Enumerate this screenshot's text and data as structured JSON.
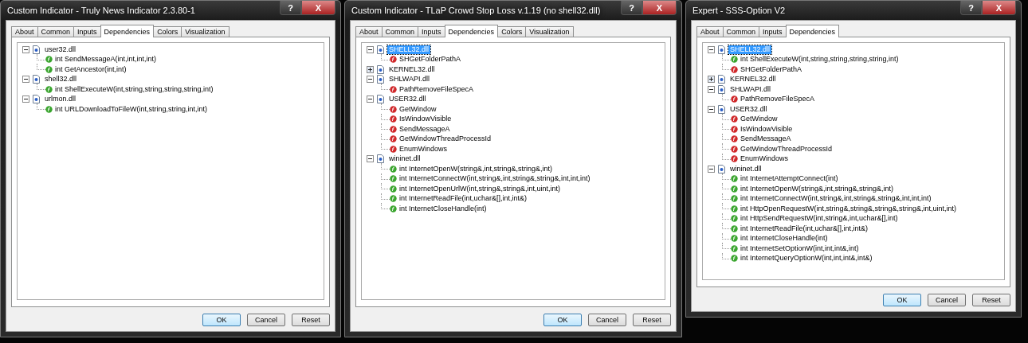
{
  "windows": [
    {
      "title": "Custom Indicator - Truly News Indicator 2.3.80-1",
      "help": "?",
      "close": "X",
      "tabs": [
        {
          "label": "About",
          "selected": false
        },
        {
          "label": "Common",
          "selected": false
        },
        {
          "label": "Inputs",
          "selected": false
        },
        {
          "label": "Dependencies",
          "selected": true
        },
        {
          "label": "Colors",
          "selected": false
        },
        {
          "label": "Visualization",
          "selected": false
        }
      ],
      "tree": [
        {
          "label": "user32.dll",
          "expanded": true,
          "selected": false,
          "children": [
            {
              "label": "int SendMessageA(int,int,int,int)",
              "kind": "allowed"
            },
            {
              "label": "int GetAncestor(int,int)",
              "kind": "allowed"
            }
          ]
        },
        {
          "label": "shell32.dll",
          "expanded": true,
          "selected": false,
          "children": [
            {
              "label": "int ShellExecuteW(int,string,string,string,string,int)",
              "kind": "allowed"
            }
          ]
        },
        {
          "label": "urlmon.dll",
          "expanded": true,
          "selected": false,
          "children": [
            {
              "label": "int URLDownloadToFileW(int,string,string,int,int)",
              "kind": "allowed"
            }
          ]
        }
      ],
      "buttons": [
        {
          "label": "OK",
          "default": true
        },
        {
          "label": "Cancel",
          "default": false
        },
        {
          "label": "Reset",
          "default": false
        }
      ]
    },
    {
      "title": "Custom Indicator - TLaP Crowd Stop Loss v.1.19 (no shell32.dll)",
      "help": "?",
      "close": "X",
      "tabs": [
        {
          "label": "About",
          "selected": false
        },
        {
          "label": "Common",
          "selected": false
        },
        {
          "label": "Inputs",
          "selected": false
        },
        {
          "label": "Dependencies",
          "selected": true
        },
        {
          "label": "Colors",
          "selected": false
        },
        {
          "label": "Visualization",
          "selected": false
        }
      ],
      "tree": [
        {
          "label": "SHELL32.dll",
          "expanded": true,
          "selected": true,
          "children": [
            {
              "label": "SHGetFolderPathA",
              "kind": "blocked"
            }
          ]
        },
        {
          "label": "KERNEL32.dll",
          "expanded": false,
          "selected": false
        },
        {
          "label": "SHLWAPI.dll",
          "expanded": true,
          "selected": false,
          "children": [
            {
              "label": "PathRemoveFileSpecA",
              "kind": "blocked"
            }
          ]
        },
        {
          "label": "USER32.dll",
          "expanded": true,
          "selected": false,
          "children": [
            {
              "label": "GetWindow",
              "kind": "blocked"
            },
            {
              "label": "IsWindowVisible",
              "kind": "blocked"
            },
            {
              "label": "SendMessageA",
              "kind": "blocked"
            },
            {
              "label": "GetWindowThreadProcessId",
              "kind": "blocked"
            },
            {
              "label": "EnumWindows",
              "kind": "blocked"
            }
          ]
        },
        {
          "label": "wininet.dll",
          "expanded": true,
          "selected": false,
          "children": [
            {
              "label": "int InternetOpenW(string&,int,string&,string&,int)",
              "kind": "allowed"
            },
            {
              "label": "int InternetConnectW(int,string&,int,string&,string&,int,int,int)",
              "kind": "allowed"
            },
            {
              "label": "int InternetOpenUrlW(int,string&,string&,int,uint,int)",
              "kind": "allowed"
            },
            {
              "label": "int InternetReadFile(int,uchar&[],int,int&)",
              "kind": "allowed"
            },
            {
              "label": "int InternetCloseHandle(int)",
              "kind": "allowed"
            }
          ]
        }
      ],
      "buttons": [
        {
          "label": "OK",
          "default": true
        },
        {
          "label": "Cancel",
          "default": false
        },
        {
          "label": "Reset",
          "default": false
        }
      ]
    },
    {
      "title": "Expert - SSS-Option V2",
      "help": "?",
      "close": "X",
      "tabs": [
        {
          "label": "About",
          "selected": false
        },
        {
          "label": "Common",
          "selected": false
        },
        {
          "label": "Inputs",
          "selected": false
        },
        {
          "label": "Dependencies",
          "selected": true
        }
      ],
      "tree": [
        {
          "label": "SHELL32.dll",
          "expanded": true,
          "selected": true,
          "children": [
            {
              "label": "int ShellExecuteW(int,string,string,string,string,int)",
              "kind": "allowed"
            },
            {
              "label": "SHGetFolderPathA",
              "kind": "blocked"
            }
          ]
        },
        {
          "label": "KERNEL32.dll",
          "expanded": false,
          "selected": false
        },
        {
          "label": "SHLWAPI.dll",
          "expanded": true,
          "selected": false,
          "children": [
            {
              "label": "PathRemoveFileSpecA",
              "kind": "blocked"
            }
          ]
        },
        {
          "label": "USER32.dll",
          "expanded": true,
          "selected": false,
          "children": [
            {
              "label": "GetWindow",
              "kind": "blocked"
            },
            {
              "label": "IsWindowVisible",
              "kind": "blocked"
            },
            {
              "label": "SendMessageA",
              "kind": "blocked"
            },
            {
              "label": "GetWindowThreadProcessId",
              "kind": "blocked"
            },
            {
              "label": "EnumWindows",
              "kind": "blocked"
            }
          ]
        },
        {
          "label": "wininet.dll",
          "expanded": true,
          "selected": false,
          "children": [
            {
              "label": "int InternetAttemptConnect(int)",
              "kind": "allowed"
            },
            {
              "label": "int InternetOpenW(string&,int,string&,string&,int)",
              "kind": "allowed"
            },
            {
              "label": "int InternetConnectW(int,string&,int,string&,string&,int,int,int)",
              "kind": "allowed"
            },
            {
              "label": "int HttpOpenRequestW(int,string&,string&,string&,string&,int,uint,int)",
              "kind": "allowed"
            },
            {
              "label": "int HttpSendRequestW(int,string&,int,uchar&[],int)",
              "kind": "allowed"
            },
            {
              "label": "int InternetReadFile(int,uchar&[],int,int&)",
              "kind": "allowed"
            },
            {
              "label": "int InternetCloseHandle(int)",
              "kind": "allowed"
            },
            {
              "label": "int InternetSetOptionW(int,int,int&,int)",
              "kind": "allowed"
            },
            {
              "label": "int InternetQueryOptionW(int,int,int&,int&)",
              "kind": "allowed"
            }
          ]
        }
      ],
      "buttons": [
        {
          "label": "OK",
          "default": true
        },
        {
          "label": "Cancel",
          "default": false
        },
        {
          "label": "Reset",
          "default": false
        }
      ]
    }
  ]
}
